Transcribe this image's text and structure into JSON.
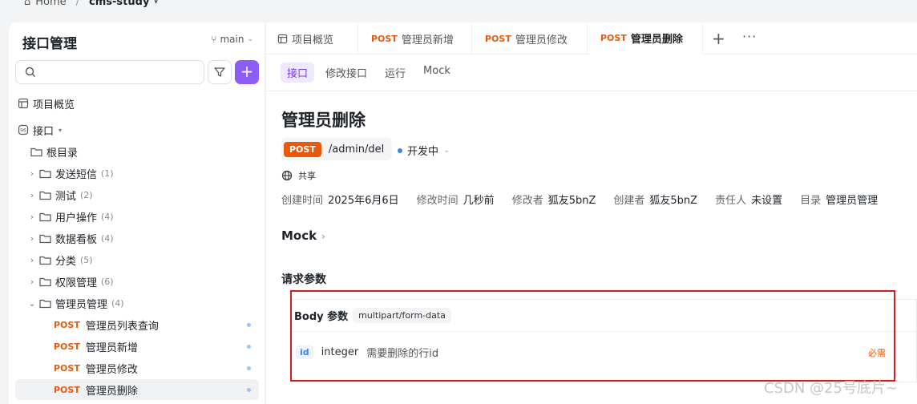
{
  "topbar": {
    "home": "Home",
    "separator": "/",
    "project": "cms-study"
  },
  "sidebar": {
    "title": "接口管理",
    "branch": "main",
    "tree": [
      {
        "label": "项目概览",
        "icon": "overview-icon"
      },
      {
        "label": "接口",
        "icon": "api-icon"
      },
      {
        "label": "根目录",
        "icon": "folder-icon"
      },
      {
        "label": "发送短信",
        "count": "(1)"
      },
      {
        "label": "测试",
        "count": "(2)"
      },
      {
        "label": "用户操作",
        "count": "(4)"
      },
      {
        "label": "数据看板",
        "count": "(4)"
      },
      {
        "label": "分类",
        "count": "(5)"
      },
      {
        "label": "权限管理",
        "count": "(6)"
      },
      {
        "label": "管理员管理",
        "count": "(4)"
      }
    ],
    "endpoints": [
      {
        "method": "POST",
        "label": "管理员列表查询"
      },
      {
        "method": "POST",
        "label": "管理员新增"
      },
      {
        "method": "POST",
        "label": "管理员修改"
      },
      {
        "method": "POST",
        "label": "管理员删除"
      }
    ]
  },
  "tabs": [
    {
      "method": "",
      "label": "项目概览"
    },
    {
      "method": "POST",
      "label": "管理员新增"
    },
    {
      "method": "POST",
      "label": "管理员修改"
    },
    {
      "method": "POST",
      "label": "管理员删除"
    }
  ],
  "tab_actions": {
    "add": "+",
    "more": "···"
  },
  "subtabs": [
    "接口",
    "修改接口",
    "运行",
    "Mock"
  ],
  "api": {
    "title": "管理员删除",
    "method": "POST",
    "path": "/admin/del",
    "status": "开发中",
    "share": "共享",
    "meta": [
      {
        "key": "创建时间",
        "value": "2025年6月6日"
      },
      {
        "key": "修改时间",
        "value": "几秒前"
      },
      {
        "key": "修改者",
        "value": "狐友5bnZ"
      },
      {
        "key": "创建者",
        "value": "狐友5bnZ"
      },
      {
        "key": "责任人",
        "value": "未设置"
      },
      {
        "key": "目录",
        "value": "管理员管理"
      }
    ],
    "mock_label": "Mock",
    "request_title": "请求参数",
    "body_label": "Body 参数",
    "content_type": "multipart/form-data",
    "param": {
      "name": "id",
      "type": "integer",
      "desc": "需要删除的行id",
      "required": "必需"
    }
  },
  "watermark": "CSDN @25号底片~"
}
